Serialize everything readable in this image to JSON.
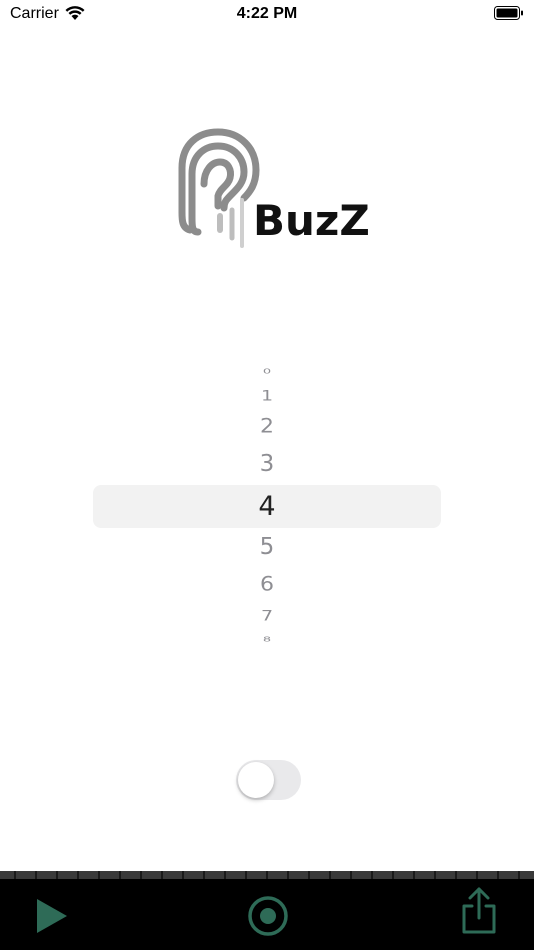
{
  "status_bar": {
    "carrier": "Carrier",
    "time": "4:22 PM",
    "wifi_icon": "wifi-icon",
    "battery_icon": "battery-full-icon"
  },
  "logo": {
    "text": "BuzZ",
    "icon": "ear-icon"
  },
  "picker": {
    "items": [
      "0",
      "1",
      "2",
      "3",
      "4",
      "5",
      "6",
      "7",
      "8"
    ],
    "selected": "4"
  },
  "toggle": {
    "on": false
  },
  "bottom_bar": {
    "play_icon": "play-icon",
    "record_icon": "record-icon",
    "share_icon": "share-icon",
    "accent_color": "#2e6b57"
  }
}
